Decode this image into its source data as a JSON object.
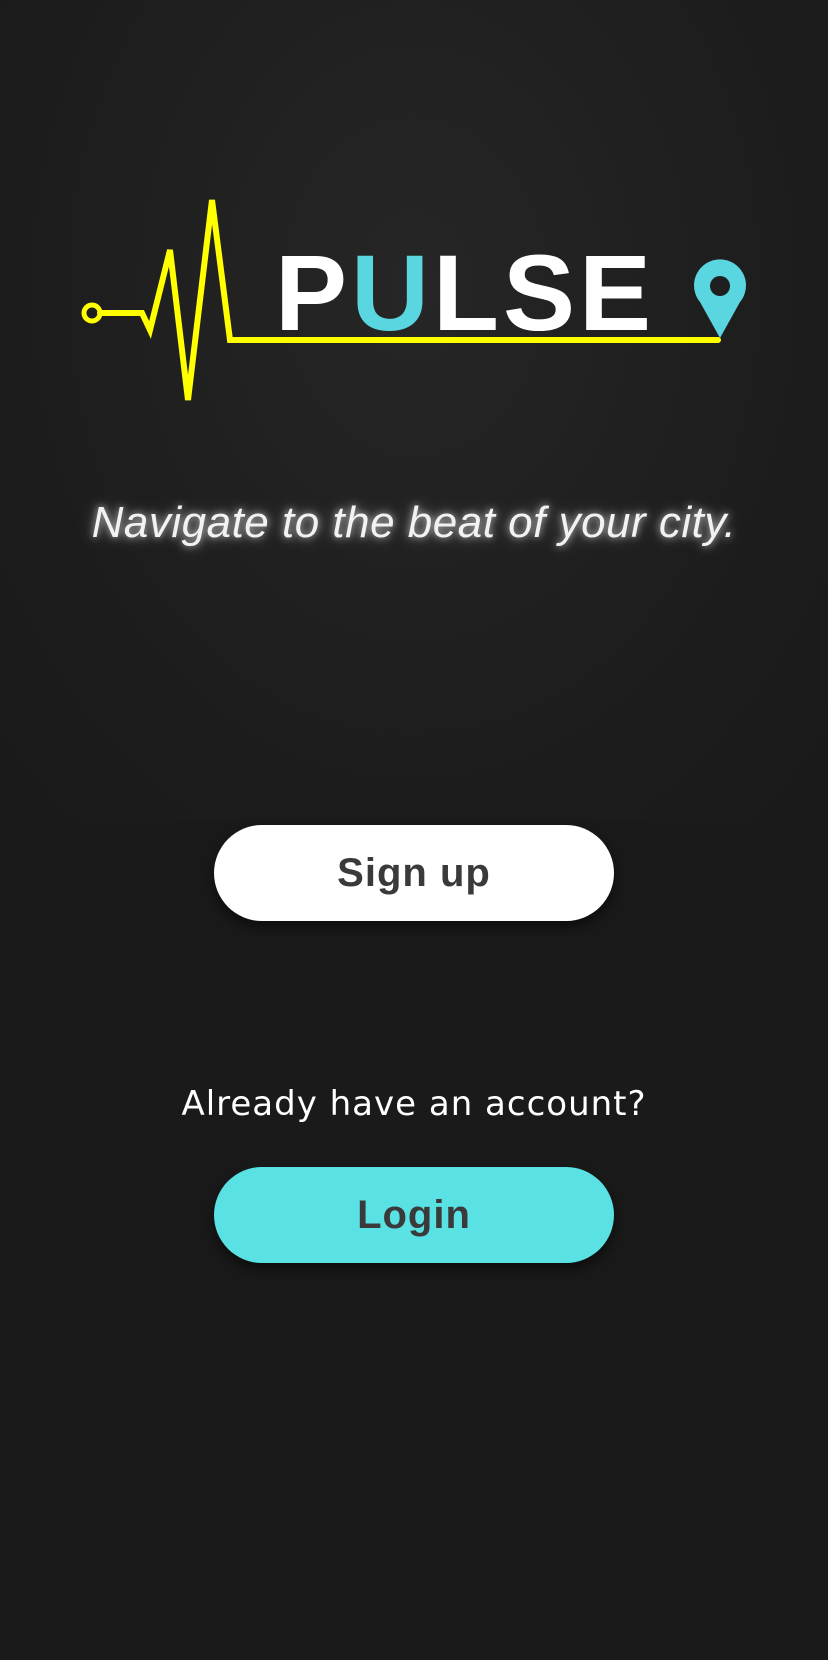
{
  "logo": {
    "wordmark_left": "P",
    "wordmark_accent": "U",
    "wordmark_right": "LSE",
    "pulse_color": "#ffff00",
    "accent_color": "#5ad6e0",
    "text_color": "#ffffff",
    "icons": [
      "heartbeat-line-icon",
      "map-pin-icon"
    ]
  },
  "tagline": "Navigate to the beat of your city.",
  "signup": {
    "label": "Sign up",
    "background": "#ffffff"
  },
  "login_prompt": "Already have an account?",
  "login": {
    "label": "Login",
    "background": "#5ae1e4"
  },
  "colors": {
    "background": "#1a1a1a",
    "button_text": "#3a3a3a"
  }
}
